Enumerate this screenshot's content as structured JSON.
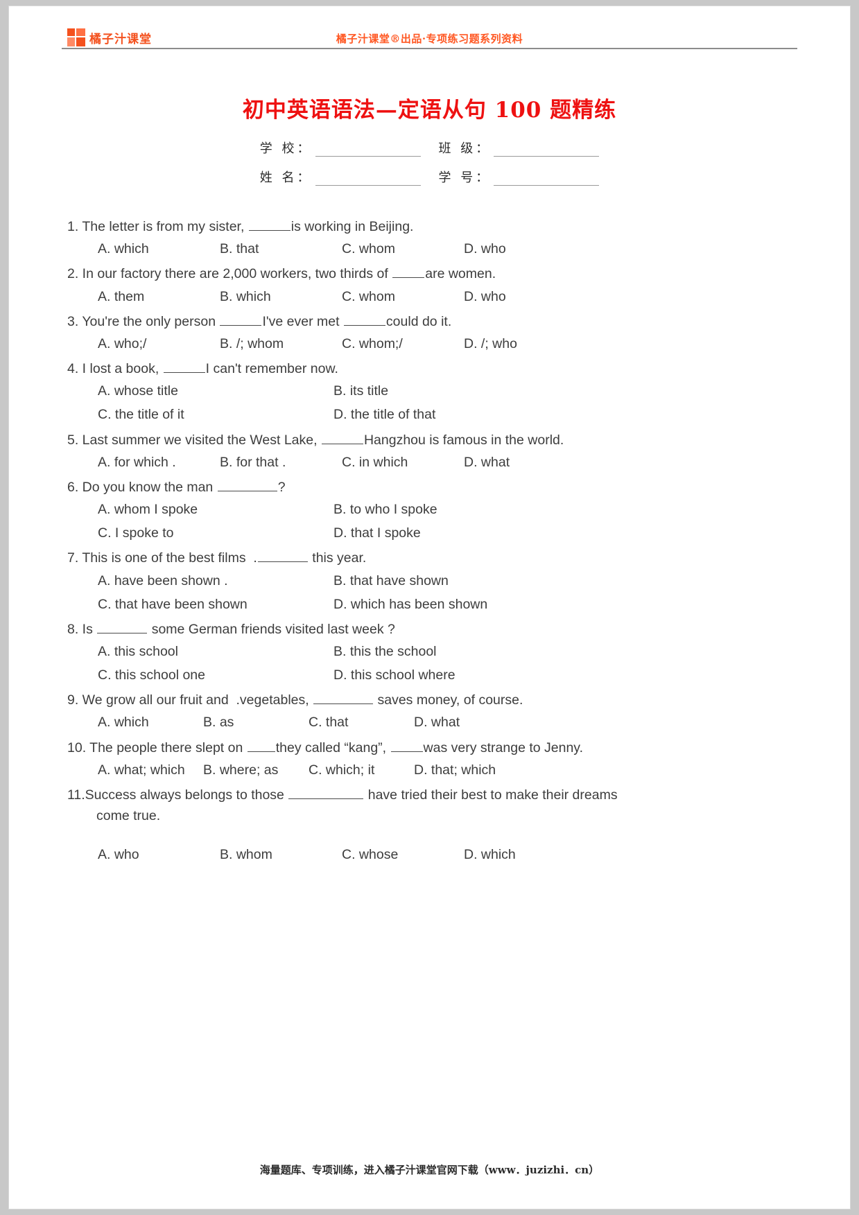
{
  "header": {
    "brand_name": "橘子汁课堂",
    "center_text": "橘子汁课堂®出品·专项练习题系列资料"
  },
  "title": "初中英语语法—定语从句 100 题精练",
  "form": {
    "school_label": "学 校：",
    "class_label": "班 级：",
    "name_label": "姓 名：",
    "id_label": "学 号："
  },
  "questions": [
    {
      "stem_a": "1. The letter is from my sister, ",
      "stem_b": "is working in Beijing.",
      "options": [
        "A. which",
        "B. that",
        "C. whom",
        "D. who"
      ]
    },
    {
      "stem_a": "2. In our factory there are 2,000 workers, two thirds of ",
      "stem_b": "are women.",
      "options": [
        "A. them",
        "B. which",
        "C. whom",
        "D. who"
      ]
    },
    {
      "stem_a": "3. You're the only person ",
      "stem_b": "I've ever met ",
      "stem_c": "could do it.",
      "options": [
        "A. who;/",
        "B. /; whom",
        "C. whom;/",
        "D. /; who"
      ]
    },
    {
      "stem_a": "4. I lost a book, ",
      "stem_b": "I can't remember now.",
      "options": [
        "A. whose title",
        "B. its title",
        "C. the title of it",
        "D. the title of that"
      ]
    },
    {
      "stem_a": "5. Last summer we visited the West Lake, ",
      "stem_b": "Hangzhou is famous in the world.",
      "options": [
        "A. for which .",
        "B. for that        .",
        "C. in which",
        "D. what"
      ]
    },
    {
      "stem_a": "6. Do you know the man ",
      "stem_b": "?",
      "options": [
        "A. whom I spoke",
        "B. to who I spoke",
        "C. I spoke to",
        "D. that I spoke"
      ]
    },
    {
      "stem_a": "7. This is one of the best films  .",
      "stem_b": " this year.",
      "options": [
        "A. have been shown .",
        "B. that have shown",
        "C. that have been shown",
        "D. which has been shown"
      ]
    },
    {
      "stem_a": "8. Is ",
      "stem_b": " some German friends visited last week ?",
      "options": [
        "A. this school",
        "B. this the school",
        "C. this school one",
        "D. this school where"
      ]
    },
    {
      "stem_a": "9. We grow all our fruit and  .vegetables, ",
      "stem_b": " saves money, of course.",
      "options": [
        "A. which",
        "B. as",
        "C. that",
        "D. what"
      ]
    },
    {
      "stem_a": "10. The people there slept on ",
      "stem_b": "they called “kang”, ",
      "stem_c": "was very strange to Jenny.",
      "options": [
        "A. what; which",
        "B. where; as",
        "C. which; it",
        "D. that; which"
      ]
    },
    {
      "stem_a": "11.Success always belongs to those ",
      "stem_b": " have tried their best to make their dreams",
      "stem_cont": "come true.",
      "options": [
        "A. who",
        "B. whom",
        "C. whose",
        "D. which"
      ]
    }
  ],
  "footer": {
    "text": "海量题库、专项训练，进入橘子汁课堂官网下载（www．juzizhi．cn）"
  }
}
